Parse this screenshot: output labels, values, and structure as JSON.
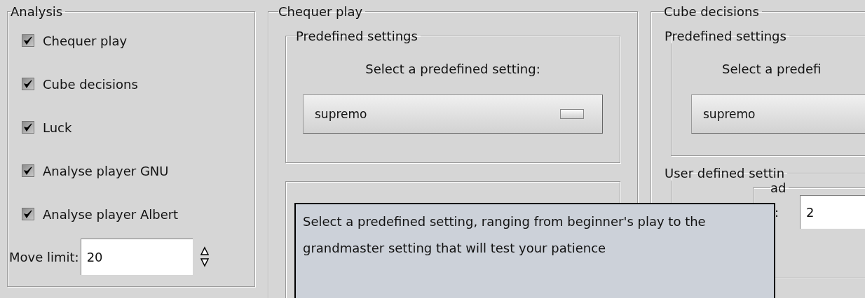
{
  "analysis": {
    "title": "Analysis",
    "options": [
      {
        "label": "Chequer play",
        "checked": true
      },
      {
        "label": "Cube decisions",
        "checked": true
      },
      {
        "label": "Luck",
        "checked": true
      },
      {
        "label": "Analyse player GNU",
        "checked": true
      },
      {
        "label": "Analyse player Albert",
        "checked": true
      }
    ],
    "move_limit": {
      "label": "Move limit:",
      "value": "20"
    }
  },
  "chequer_play": {
    "title": "Chequer play",
    "predefined": {
      "title": "Predefined settings",
      "prompt": "Select a predefined setting:",
      "setting": "supremo"
    }
  },
  "cube_decisions": {
    "title": "Cube decisions",
    "predefined": {
      "title": "Predefined settings",
      "prompt": "Select a predefi",
      "setting": "supremo"
    },
    "user_defined": {
      "title": "User defined settin",
      "lookahead": {
        "title": "ad",
        "label": ":",
        "value": "2"
      }
    }
  },
  "tooltip": {
    "text": "Select a predefined setting, ranging from beginner's play to the grandmaster setting that will test your patience"
  }
}
